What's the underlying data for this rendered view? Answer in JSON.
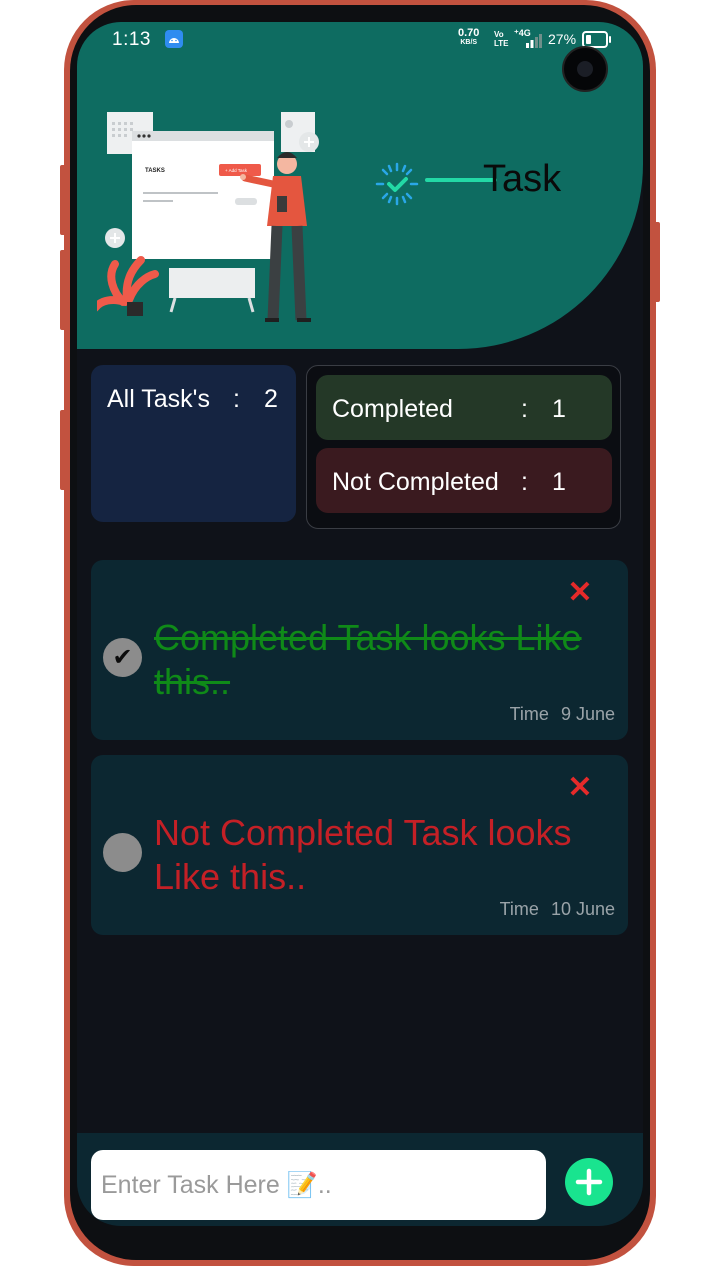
{
  "status_bar": {
    "time": "1:13",
    "net_speed_value": "0.70",
    "net_speed_unit": "KB/S",
    "volte_top": "Vo",
    "volte_bottom": "LTE",
    "network": "⁺4G",
    "battery": "27%"
  },
  "header": {
    "title": "Task",
    "illustration": {
      "panel_title": "TASKS",
      "add_button": "+ Add Task"
    }
  },
  "summary": {
    "all_label": "All Task's",
    "all_count": "2",
    "completed_label": "Completed",
    "completed_count": "1",
    "not_completed_label": "Not Completed",
    "not_completed_count": "1",
    "separator": ":"
  },
  "tasks": [
    {
      "text": "Completed Task looks Like this..",
      "completed": true,
      "time_label": "Time",
      "date": "9 June",
      "check_mark": "✔",
      "delete_icon": "✕"
    },
    {
      "text": "Not Completed Task looks Like this..",
      "completed": false,
      "time_label": "Time",
      "date": "10 June",
      "check_mark": "",
      "delete_icon": "✕"
    }
  ],
  "input": {
    "placeholder": "Enter Task Here 📝.."
  },
  "colors": {
    "header": "#0e6c61",
    "background": "#0f1219",
    "card": "#0c2731",
    "completed": "#0f8a18",
    "not_completed": "#c42026",
    "accent": "#19e48f"
  }
}
